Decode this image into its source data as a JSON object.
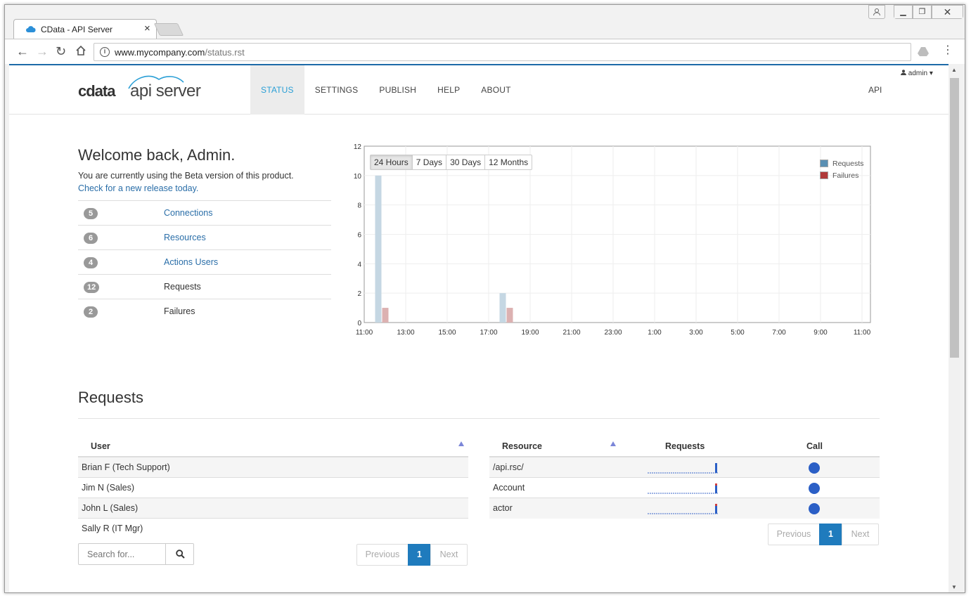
{
  "browser": {
    "tab_title": "CData - API Server",
    "url_host": "www.mycompany.com",
    "url_path": "/status.rst"
  },
  "header": {
    "logo_cdata": "cdata",
    "logo_product": "api server",
    "nav": [
      "STATUS",
      "SETTINGS",
      "PUBLISH",
      "HELP",
      "ABOUT"
    ],
    "active_nav": "STATUS",
    "api_link": "API",
    "user": "admin"
  },
  "welcome": {
    "title": "Welcome back, Admin.",
    "text": "You are currently using the Beta version of this product.",
    "link": "Check for a new release today."
  },
  "stats": [
    {
      "count": "5",
      "label": "Connections",
      "link": true
    },
    {
      "count": "6",
      "label": "Resources",
      "link": true
    },
    {
      "count": "4",
      "label": "Actions Users",
      "link": true
    },
    {
      "count": "12",
      "label": "Requests",
      "link": false
    },
    {
      "count": "2",
      "label": "Failures",
      "link": false
    }
  ],
  "chart_ranges": [
    "24 Hours",
    "7 Days",
    "30 Days",
    "12 Months"
  ],
  "chart_active_range": "24 Hours",
  "chart_data": {
    "type": "bar",
    "title": "",
    "xlabel": "",
    "ylabel": "",
    "ylim": [
      0,
      12
    ],
    "y_ticks": [
      0,
      2,
      4,
      6,
      8,
      10,
      12
    ],
    "x_tick_labels": [
      "11:00",
      "13:00",
      "15:00",
      "17:00",
      "19:00",
      "21:00",
      "23:00",
      "1:00",
      "3:00",
      "5:00",
      "7:00",
      "9:00",
      "11:00"
    ],
    "categories": [
      "12:00",
      "18:00"
    ],
    "series": [
      {
        "name": "Requests",
        "color": "#c5d7e3",
        "legend_color": "#5a8fb3",
        "values": [
          10,
          2
        ]
      },
      {
        "name": "Failures",
        "color": "#dcb1b1",
        "legend_color": "#b03a3a",
        "values": [
          1,
          1
        ]
      }
    ],
    "grid": true,
    "legend": "top-right"
  },
  "requests": {
    "title": "Requests",
    "users_header": "User",
    "users": [
      "Brian F (Tech Support)",
      "Jim N (Sales)",
      "John L (Sales)",
      "Sally R (IT Mgr)"
    ],
    "search_placeholder": "Search for...",
    "resource_headers": {
      "resource": "Resource",
      "requests": "Requests",
      "call": "Call"
    },
    "resources": [
      "/api.rsc/",
      "Account",
      "actor"
    ],
    "pager": {
      "prev": "Previous",
      "page": "1",
      "next": "Next"
    }
  },
  "colors": {
    "accent": "#2a9fd6",
    "link": "#2a6ea8",
    "pager_active": "#1f7bbd",
    "call_dot": "#2b5fc6"
  }
}
